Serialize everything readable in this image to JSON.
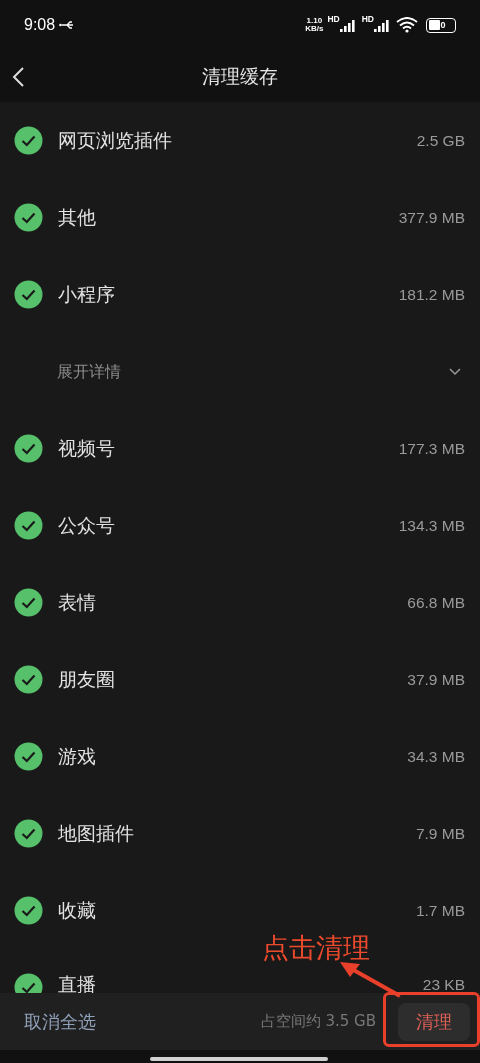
{
  "status_bar": {
    "time": "9:08",
    "net_speed_value": "1.10",
    "net_speed_unit": "KB/s",
    "sim_labels": [
      "HD",
      "HD"
    ],
    "battery_level_text": "0"
  },
  "header": {
    "title": "清理缓存"
  },
  "items": [
    {
      "kind": "item",
      "label": "网页浏览插件",
      "size": "2.5 GB",
      "checked": true
    },
    {
      "kind": "item",
      "label": "其他",
      "size": "377.9 MB",
      "checked": true
    },
    {
      "kind": "item",
      "label": "小程序",
      "size": "181.2 MB",
      "checked": true
    },
    {
      "kind": "expander",
      "label": "展开详情",
      "expanded": false
    },
    {
      "kind": "item",
      "label": "视频号",
      "size": "177.3 MB",
      "checked": true
    },
    {
      "kind": "item",
      "label": "公众号",
      "size": "134.3 MB",
      "checked": true
    },
    {
      "kind": "item",
      "label": "表情",
      "size": "66.8 MB",
      "checked": true
    },
    {
      "kind": "item",
      "label": "朋友圈",
      "size": "37.9 MB",
      "checked": true
    },
    {
      "kind": "item",
      "label": "游戏",
      "size": "34.3 MB",
      "checked": true
    },
    {
      "kind": "item",
      "label": "地图插件",
      "size": "7.9 MB",
      "checked": true
    },
    {
      "kind": "item",
      "label": "收藏",
      "size": "1.7 MB",
      "checked": true
    },
    {
      "kind": "item",
      "label": "直播",
      "size": "23 KB",
      "checked": true
    }
  ],
  "footer": {
    "deselect_all": "取消全选",
    "summary": "占空间约 3.5 GB",
    "clean_button": "清理"
  },
  "annotation": {
    "text": "点击清理"
  }
}
